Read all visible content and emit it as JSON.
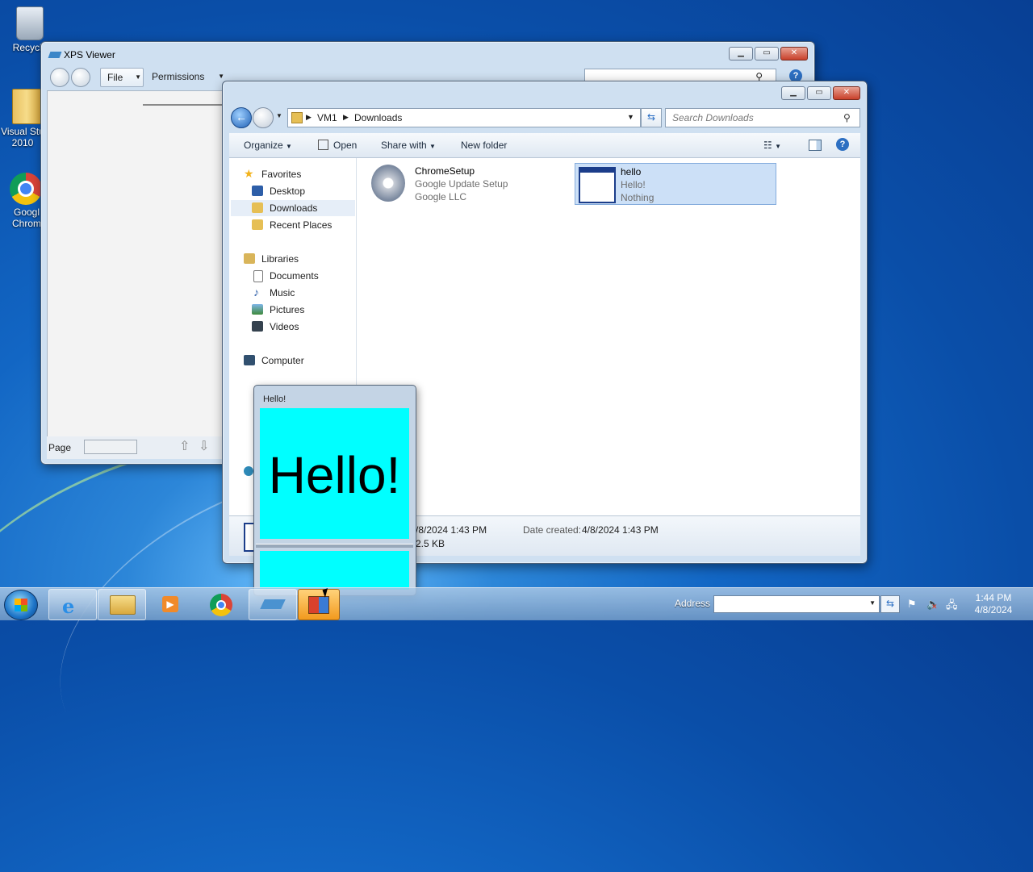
{
  "desktop": {
    "icons": [
      {
        "label": "Recycle"
      },
      {
        "label": "Visual Stu 2010"
      },
      {
        "label": "Googl Chrom"
      }
    ]
  },
  "xps_viewer": {
    "title": "XPS Viewer",
    "menu": {
      "file": "File",
      "permissions": "Permissions"
    },
    "status": {
      "page_label": "Page"
    }
  },
  "explorer": {
    "breadcrumb": [
      "VM1",
      "Downloads"
    ],
    "search_placeholder": "Search Downloads",
    "commands": {
      "organize": "Organize",
      "open": "Open",
      "share_with": "Share with",
      "new_folder": "New folder"
    },
    "nav": {
      "favorites": "Favorites",
      "desktop": "Desktop",
      "downloads": "Downloads",
      "recent_places": "Recent Places",
      "libraries": "Libraries",
      "documents": "Documents",
      "music": "Music",
      "pictures": "Pictures",
      "videos": "Videos",
      "computer": "Computer"
    },
    "files": [
      {
        "name": "ChromeSetup",
        "line2": "Google Update Setup",
        "line3": "Google LLC"
      },
      {
        "name": "hello",
        "line2": "Hello!",
        "line3": "Nothing"
      }
    ],
    "details": {
      "modified": "/8/2024 1:43 PM",
      "size": "2.5 KB",
      "created_label": "Date created:",
      "created_value": "4/8/2024 1:43 PM"
    }
  },
  "hello_window": {
    "title": "Hello!",
    "content_text": "Hello!",
    "bg_color": "#00ffff"
  },
  "taskbar": {
    "address_label": "Address",
    "clock_time": "1:44 PM",
    "clock_date": "4/8/2024"
  }
}
